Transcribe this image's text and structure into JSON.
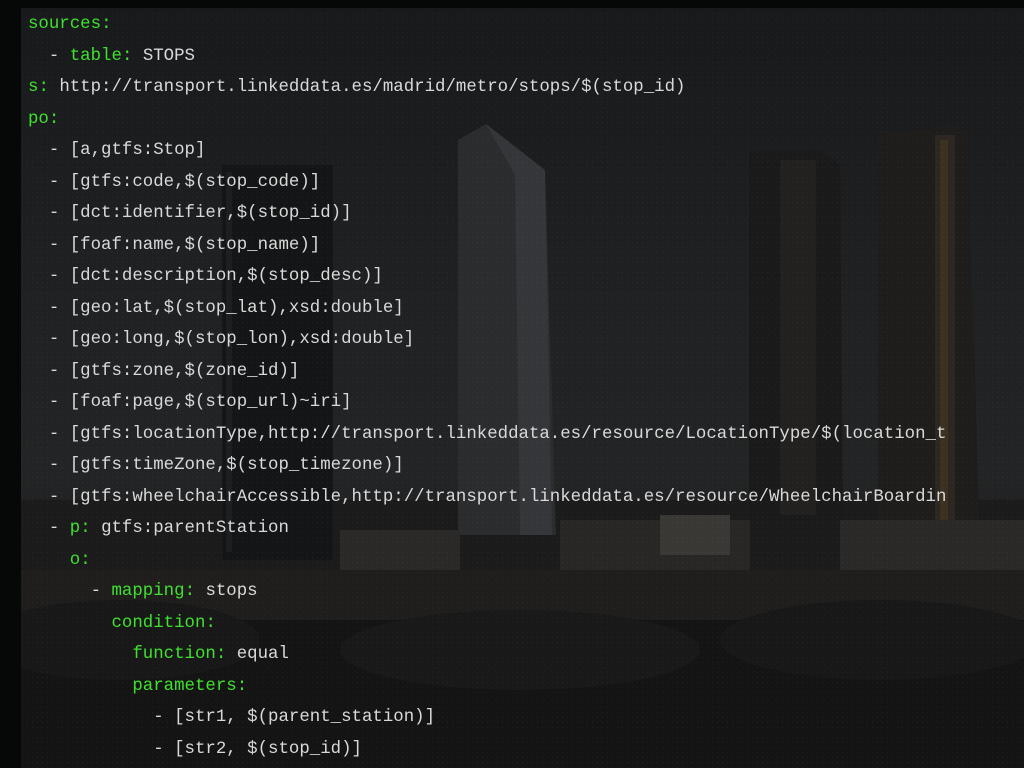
{
  "colors": {
    "key": "#3fe02f",
    "text": "#d9d9d9",
    "background": "#1f2123"
  },
  "code_lines": [
    {
      "indent": "",
      "dash": "",
      "key": "sources",
      "colon": ":",
      "value": ""
    },
    {
      "indent": "  ",
      "dash": "- ",
      "key": "table",
      "colon": ": ",
      "value": "STOPS"
    },
    {
      "indent": "",
      "dash": "",
      "key": "s",
      "colon": ": ",
      "value": "http://transport.linkeddata.es/madrid/metro/stops/$(stop_id)"
    },
    {
      "indent": "",
      "dash": "",
      "key": "po",
      "colon": ":",
      "value": ""
    },
    {
      "indent": "  ",
      "dash": "- ",
      "key": "",
      "colon": "",
      "value": "[a,gtfs:Stop]"
    },
    {
      "indent": "  ",
      "dash": "- ",
      "key": "",
      "colon": "",
      "value": "[gtfs:code,$(stop_code)]"
    },
    {
      "indent": "  ",
      "dash": "- ",
      "key": "",
      "colon": "",
      "value": "[dct:identifier,$(stop_id)]"
    },
    {
      "indent": "  ",
      "dash": "- ",
      "key": "",
      "colon": "",
      "value": "[foaf:name,$(stop_name)]"
    },
    {
      "indent": "  ",
      "dash": "- ",
      "key": "",
      "colon": "",
      "value": "[dct:description,$(stop_desc)]"
    },
    {
      "indent": "  ",
      "dash": "- ",
      "key": "",
      "colon": "",
      "value": "[geo:lat,$(stop_lat),xsd:double]"
    },
    {
      "indent": "  ",
      "dash": "- ",
      "key": "",
      "colon": "",
      "value": "[geo:long,$(stop_lon),xsd:double]"
    },
    {
      "indent": "  ",
      "dash": "- ",
      "key": "",
      "colon": "",
      "value": "[gtfs:zone,$(zone_id)]"
    },
    {
      "indent": "  ",
      "dash": "- ",
      "key": "",
      "colon": "",
      "value": "[foaf:page,$(stop_url)~iri]"
    },
    {
      "indent": "  ",
      "dash": "- ",
      "key": "",
      "colon": "",
      "value": "[gtfs:locationType,http://transport.linkeddata.es/resource/LocationType/$(location_t"
    },
    {
      "indent": "  ",
      "dash": "- ",
      "key": "",
      "colon": "",
      "value": "[gtfs:timeZone,$(stop_timezone)]"
    },
    {
      "indent": "  ",
      "dash": "- ",
      "key": "",
      "colon": "",
      "value": "[gtfs:wheelchairAccessible,http://transport.linkeddata.es/resource/WheelchairBoardin"
    },
    {
      "indent": "  ",
      "dash": "- ",
      "key": "p",
      "colon": ": ",
      "value": "gtfs:parentStation"
    },
    {
      "indent": "    ",
      "dash": "",
      "key": "o",
      "colon": ":",
      "value": ""
    },
    {
      "indent": "      ",
      "dash": "- ",
      "key": "mapping",
      "colon": ": ",
      "value": "stops"
    },
    {
      "indent": "        ",
      "dash": "",
      "key": "condition",
      "colon": ":",
      "value": ""
    },
    {
      "indent": "          ",
      "dash": "",
      "key": "function",
      "colon": ": ",
      "value": "equal"
    },
    {
      "indent": "          ",
      "dash": "",
      "key": "parameters",
      "colon": ":",
      "value": ""
    },
    {
      "indent": "            ",
      "dash": "- ",
      "key": "",
      "colon": "",
      "value": "[str1, $(parent_station)]"
    },
    {
      "indent": "            ",
      "dash": "- ",
      "key": "",
      "colon": "",
      "value": "[str2, $(stop_id)]"
    }
  ]
}
